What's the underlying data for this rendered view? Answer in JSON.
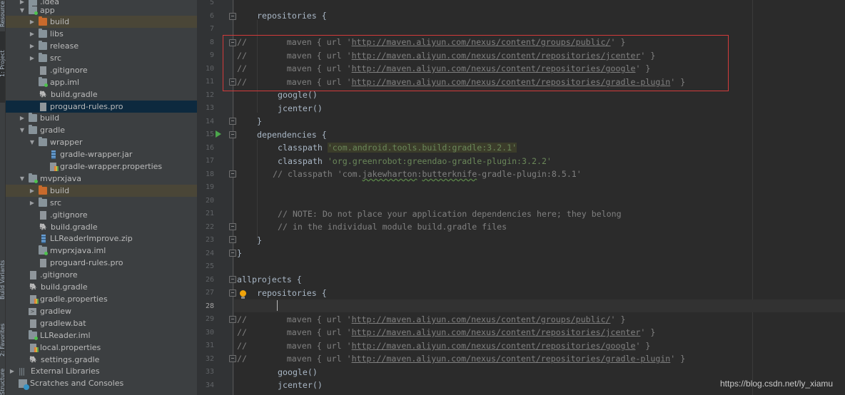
{
  "tool_stripe": {
    "labels": [
      "Resource Manager",
      "1: Project",
      "Build Variants",
      "2: Favorites",
      "Structure"
    ]
  },
  "project_tree": {
    "rows": [
      {
        "label": ".idea",
        "arrow": "▶",
        "icon": "folder-icon"
      },
      {
        "label": "app",
        "arrow": "▼",
        "icon": "module-folder-icon"
      },
      {
        "label": "build",
        "arrow": "▶",
        "icon": "excluded-folder-icon"
      },
      {
        "label": "libs",
        "arrow": "▶",
        "icon": "folder-icon"
      },
      {
        "label": "release",
        "arrow": "▶",
        "icon": "folder-icon"
      },
      {
        "label": "src",
        "arrow": "▶",
        "icon": "folder-icon"
      },
      {
        "label": ".gitignore",
        "arrow": "",
        "icon": "ignore-file-icon"
      },
      {
        "label": "app.iml",
        "arrow": "",
        "icon": "iml-file-icon"
      },
      {
        "label": "build.gradle",
        "arrow": "",
        "icon": "gradle-icon"
      },
      {
        "label": "proguard-rules.pro",
        "arrow": "",
        "icon": "text-file-icon"
      },
      {
        "label": "build",
        "arrow": "▶",
        "icon": "folder-icon"
      },
      {
        "label": "gradle",
        "arrow": "▼",
        "icon": "folder-icon"
      },
      {
        "label": "wrapper",
        "arrow": "▼",
        "icon": "folder-icon"
      },
      {
        "label": "gradle-wrapper.jar",
        "arrow": "",
        "icon": "jar-icon"
      },
      {
        "label": "gradle-wrapper.properties",
        "arrow": "",
        "icon": "properties-icon"
      },
      {
        "label": "mvprxjava",
        "arrow": "▼",
        "icon": "module-folder-icon"
      },
      {
        "label": "build",
        "arrow": "▶",
        "icon": "excluded-folder-icon"
      },
      {
        "label": "src",
        "arrow": "▶",
        "icon": "folder-icon"
      },
      {
        "label": ".gitignore",
        "arrow": "",
        "icon": "ignore-file-icon"
      },
      {
        "label": "build.gradle",
        "arrow": "",
        "icon": "gradle-icon"
      },
      {
        "label": "LLReaderImprove.zip",
        "arrow": "",
        "icon": "jar-icon"
      },
      {
        "label": "mvprxjava.iml",
        "arrow": "",
        "icon": "iml-file-icon"
      },
      {
        "label": "proguard-rules.pro",
        "arrow": "",
        "icon": "text-file-icon"
      },
      {
        "label": ".gitignore",
        "arrow": "",
        "icon": "ignore-file-icon"
      },
      {
        "label": "build.gradle",
        "arrow": "",
        "icon": "gradle-icon"
      },
      {
        "label": "gradle.properties",
        "arrow": "",
        "icon": "properties-icon"
      },
      {
        "label": "gradlew",
        "arrow": "",
        "icon": "terminal-file-icon"
      },
      {
        "label": "gradlew.bat",
        "arrow": "",
        "icon": "text-file-icon"
      },
      {
        "label": "LLReader.iml",
        "arrow": "",
        "icon": "iml-file-icon"
      },
      {
        "label": "local.properties",
        "arrow": "",
        "icon": "properties-icon"
      },
      {
        "label": "settings.gradle",
        "arrow": "",
        "icon": "gradle-icon"
      },
      {
        "label": "External Libraries",
        "arrow": "▶",
        "icon": "libraries-icon"
      },
      {
        "label": "Scratches and Consoles",
        "arrow": "",
        "icon": "scratches-icon"
      }
    ]
  },
  "editor": {
    "line_numbers": [
      "5",
      "6",
      "7",
      "8",
      "9",
      "10",
      "11",
      "12",
      "13",
      "14",
      "15",
      "16",
      "17",
      "18",
      "19",
      "20",
      "21",
      "22",
      "23",
      "24",
      "25",
      "26",
      "27",
      "28",
      "29",
      "30",
      "31",
      "32",
      "33",
      "34"
    ],
    "current_line": "28",
    "lines": {
      "l6": "repositories {",
      "l8_c": "//",
      "l8_a": "        maven { url '",
      "l8_u": "http://maven.aliyun.com/nexus/content/groups/public/",
      "l8_b": "' }",
      "l9_c": "//",
      "l9_a": "        maven { url '",
      "l9_u": "http://maven.aliyun.com/nexus/content/repositories/jcenter",
      "l9_b": "' }",
      "l10_c": "//",
      "l10_a": "        maven { url '",
      "l10_u": "http://maven.aliyun.com/nexus/content/repositories/google",
      "l10_b": "' }",
      "l11_c": "//",
      "l11_a": "        maven { url '",
      "l11_u": "http://maven.aliyun.com/nexus/content/repositories/gradle-plugin",
      "l11_b": "' }",
      "l12": "google()",
      "l13": "jcenter()",
      "l14": "}",
      "l15": "dependencies {",
      "l16_a": "classpath ",
      "l16_s": "'com.android.tools.build:gradle:3.2.1'",
      "l17_a": "classpath ",
      "l17_s": "'org.greenrobot:greendao-gradle-plugin:3.2.2'",
      "l18_a": "// classpath 'com.",
      "l18_w1": "jakewharton",
      "l18_m": ":",
      "l18_w2": "butterknife",
      "l18_b": "-gradle-plugin:8.5.1'",
      "l21": "// NOTE: Do not place your application dependencies here; they belong",
      "l22": "// in the individual module build.gradle files",
      "l23": "}",
      "l24": "}",
      "l26": "allprojects {",
      "l27": "repositories {",
      "l29_c": "//",
      "l29_a": "        maven { url '",
      "l29_u": "http://maven.aliyun.com/nexus/content/groups/public/",
      "l29_b": "' }",
      "l30_c": "//",
      "l30_a": "        maven { url '",
      "l30_u": "http://maven.aliyun.com/nexus/content/repositories/jcenter",
      "l30_b": "' }",
      "l31_c": "//",
      "l31_a": "        maven { url '",
      "l31_u": "http://maven.aliyun.com/nexus/content/repositories/google",
      "l31_b": "' }",
      "l32_c": "//",
      "l32_a": "        maven { url '",
      "l32_u": "http://maven.aliyun.com/nexus/content/repositories/gradle-plugin",
      "l32_b": "' }",
      "l33": "google()",
      "l34": "jcenter()"
    }
  },
  "annotation": {
    "highlight_box_color": "#d23b3b"
  },
  "watermark": "https://blog.csdn.net/ly_xiamu"
}
